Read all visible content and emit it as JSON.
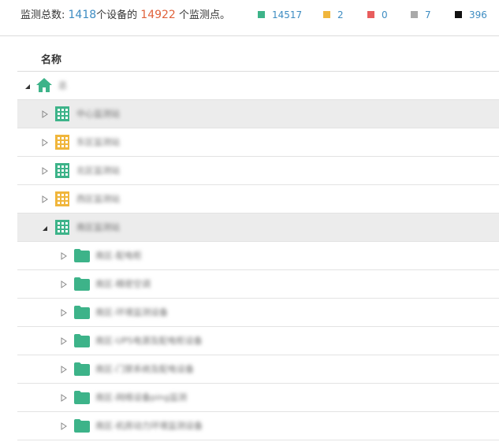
{
  "summary": {
    "prefix": "监测总数: ",
    "device_count": "1418",
    "devices_suffix": "个设备的 ",
    "point_count": "14922",
    "points_suffix": " 个监测点。"
  },
  "legend": [
    {
      "color": "#3db389",
      "value": "14517"
    },
    {
      "color": "#f0b63c",
      "value": "2"
    },
    {
      "color": "#e85d5d",
      "value": "0"
    },
    {
      "color": "#a9a9a9",
      "value": "7"
    },
    {
      "color": "#111111",
      "value": "396"
    }
  ],
  "table": {
    "column_header": "名称"
  },
  "tree": {
    "root": {
      "label": "总",
      "icon": "home-icon",
      "expanded": true
    },
    "level1": [
      {
        "label": "中心监测站",
        "status": "green",
        "expanded": false
      },
      {
        "label": "东区监测站",
        "status": "yellow",
        "expanded": false
      },
      {
        "label": "北区监测站",
        "status": "green",
        "expanded": false
      },
      {
        "label": "西区监测站",
        "status": "yellow",
        "expanded": false
      },
      {
        "label": "南区监测站",
        "status": "green",
        "expanded": true
      }
    ],
    "level2": [
      {
        "label": "南区-配电柜"
      },
      {
        "label": "南区-精密空调"
      },
      {
        "label": "南区-环境监测设备"
      },
      {
        "label": "南区-UPS电源及配电柜设备"
      },
      {
        "label": "南区-门禁系统及配电设备"
      },
      {
        "label": "南区-网络设备ping监测"
      },
      {
        "label": "南区-机房动力环境监测设备"
      }
    ]
  }
}
